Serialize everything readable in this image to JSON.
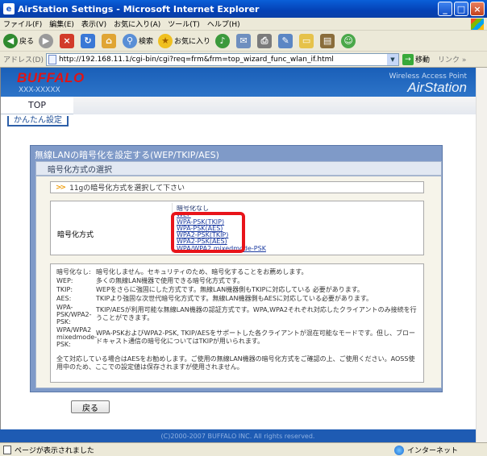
{
  "window": {
    "title": "AirStation Settings - Microsoft Internet Explorer",
    "controls": [
      "_",
      "□",
      "×"
    ]
  },
  "menubar": {
    "items": [
      "ファイル(F)",
      "編集(E)",
      "表示(V)",
      "お気に入り(A)",
      "ツール(T)",
      "ヘルプ(H)"
    ]
  },
  "toolbar": {
    "back_label": "戻る",
    "search_label": "検索",
    "favorites_label": "お気に入り"
  },
  "address": {
    "label": "アドレス(D)",
    "url": "http://192.168.11.1/cgi-bin/cgi?req=frm&frm=top_wizard_func_wlan_if.html",
    "go_label": "移動",
    "links_label": "リンク »"
  },
  "header": {
    "logo": "BUFFALO",
    "model": "XXX-XXXXX",
    "brand_sub": "Wireless Access Point",
    "brand": "AirStation"
  },
  "nav": {
    "top_tab": "TOP",
    "sub_item": "かんたん設定"
  },
  "panel": {
    "title": "無線LANの暗号化を設定する(WEP/TKIP/AES)",
    "section": "暗号化方式の選択",
    "instruction": "11gの暗号化方式を選択して下さい",
    "enc_label": "暗号化方式",
    "options": [
      "暗号化なし",
      "WEP",
      "WPA-PSK(TKIP)",
      "WPA-PSK(AES)",
      "WPA2-PSK(TKIP)",
      "WPA2-PSK(AES)",
      "WPA/WPA2 mixedmode-PSK"
    ],
    "descriptions": [
      {
        "key": "暗号化なし:",
        "text": "暗号化しません。セキュリティのため、暗号化することをお薦めします。"
      },
      {
        "key": "WEP:",
        "text": "多くの無線LAN機器で使用できる暗号化方式です。"
      },
      {
        "key": "TKIP:",
        "text": "WEPをさらに強固にした方式です。無線LAN機器側もTKIPに対応している 必要があります。"
      },
      {
        "key": "AES:",
        "text": "TKIPより強固な次世代暗号化方式です。無線LAN機器側もAESに対応している必要があります。"
      },
      {
        "key": "WPA-PSK/WPA2-PSK:",
        "text": "TKIP/AESが利用可能な無線LAN機器の認証方式です。WPA,WPA2それぞれ対応したクライアントのみ接続を行うことができます。"
      },
      {
        "key": "WPA/WPA2 mixedmode-PSK:",
        "text": "WPA-PSKおよびWPA2-PSK, TKIP/AESをサポートした各クライアントが混在可能なモードです。但し、ブロードキャスト通信の暗号化についてはTKIPが用いられます。"
      }
    ],
    "note": "全て対応している場合はAESをお勧めします。ご使用の無線LAN機器の暗号化方式をご確認の上、ご使用ください。AOSS使用中のため、ここでの設定値は保存されますが使用されません。",
    "back_button": "戻る"
  },
  "footer": {
    "copyright": "(C)2000-2007 BUFFALO INC. All rights reserved."
  },
  "statusbar": {
    "status": "ページが表示されました",
    "zone": "インターネット"
  },
  "colors": {
    "titlebar": "#0441b5",
    "header_blue": "#1a5fb8",
    "logo_red": "#e01414",
    "highlight_red": "#e8141a"
  }
}
